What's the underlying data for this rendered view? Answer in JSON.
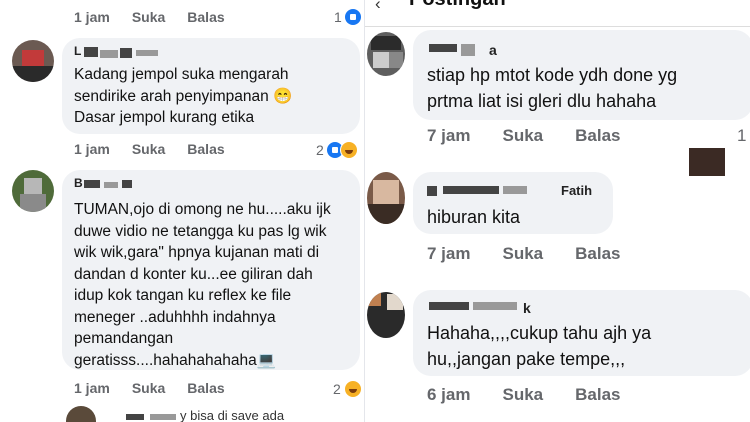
{
  "left": {
    "top_meta": {
      "time": "1 jam",
      "like": "Suka",
      "reply": "Balas",
      "count": "1"
    },
    "comments": [
      {
        "name": "L",
        "text": "Kadang jempol suka mengarah\nsendirike arah penyimpanan 😁\nDasar jempol kurang etika",
        "meta": {
          "time": "1 jam",
          "like": "Suka",
          "reply": "Balas",
          "count": "2"
        }
      },
      {
        "name": "B",
        "text": "TUMAN,ojo di omong ne hu.....aku ijk\nduwe vidio ne tetangga ku pas lg wik\nwik wik,gara\" hpnya kujanan mati di\ndandan d konter ku...ee giliran dah\nidup kok tangan ku reflex ke file\nmeneger ..aduhhhh indahnya\npemandangan\ngeratisss....hahahahahaha💻",
        "meta": {
          "time": "1 jam",
          "like": "Suka",
          "reply": "Balas",
          "count": "2"
        }
      }
    ],
    "bottom_partial": "y bisa di save ada"
  },
  "right": {
    "header": "Postingan",
    "comments": [
      {
        "name": "a",
        "text": "stiap hp mtot kode ydh done yg\nprtma liat isi gleri dlu hahaha",
        "meta": {
          "time": "7 jam",
          "like": "Suka",
          "reply": "Balas",
          "count": "1"
        }
      },
      {
        "name": "Fatih",
        "text": "hiburan kita",
        "meta": {
          "time": "7 jam",
          "like": "Suka",
          "reply": "Balas"
        }
      },
      {
        "name": "k",
        "text": "Hahaha,,,,cukup tahu ajh ya\nhu,,jangan pake tempe,,,",
        "meta": {
          "time": "6 jam",
          "like": "Suka",
          "reply": "Balas"
        }
      }
    ]
  }
}
